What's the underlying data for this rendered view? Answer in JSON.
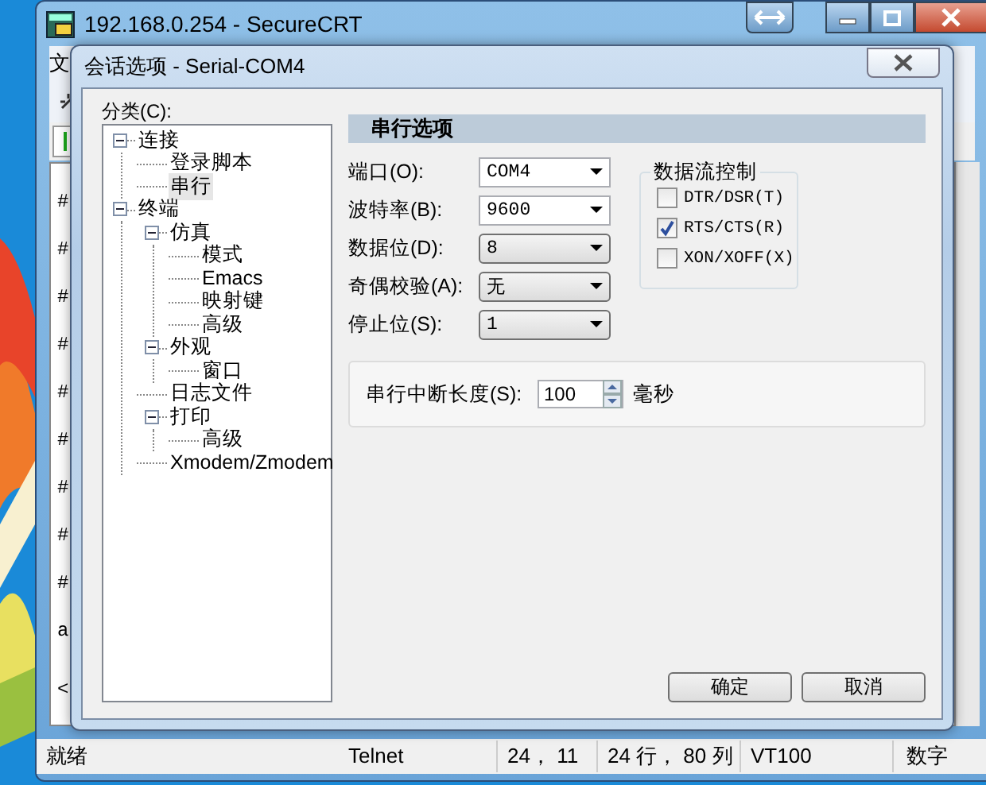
{
  "window": {
    "title": "192.168.0.254 - SecureCRT"
  },
  "menu": [
    "文"
  ],
  "terminal_lines": [
    "#",
    "#",
    "#",
    "#",
    "#",
    "#",
    "#",
    "#",
    "#",
    "a"
  ],
  "terminal_prompt": "<",
  "dialog": {
    "title": "会话选项 - Serial-COM4",
    "category_label": "分类(C):",
    "tree": [
      {
        "label": "连接",
        "expanded": true,
        "selected": false,
        "children": [
          {
            "label": "登录脚本",
            "selected": false
          },
          {
            "label": "串行",
            "selected": true
          }
        ]
      },
      {
        "label": "终端",
        "expanded": true,
        "selected": false,
        "children": [
          {
            "label": "仿真",
            "expanded": true,
            "selected": false,
            "children": [
              {
                "label": "模式",
                "selected": false
              },
              {
                "label": "Emacs",
                "selected": false
              },
              {
                "label": "映射键",
                "selected": false
              },
              {
                "label": "高级",
                "selected": false
              }
            ]
          },
          {
            "label": "外观",
            "expanded": true,
            "selected": false,
            "children": [
              {
                "label": "窗口",
                "selected": false
              }
            ]
          },
          {
            "label": "日志文件",
            "selected": false
          },
          {
            "label": "打印",
            "expanded": true,
            "selected": false,
            "children": [
              {
                "label": "高级",
                "selected": false
              }
            ]
          },
          {
            "label": "Xmodem/Zmodem",
            "selected": false
          }
        ]
      }
    ],
    "section_title": "串行选项",
    "fields": [
      {
        "label": "端口(O):",
        "value": "COM4",
        "kind": "editable"
      },
      {
        "label": "波特率(B):",
        "value": "9600",
        "kind": "editable"
      },
      {
        "label": "数据位(D):",
        "value": "8",
        "kind": "list"
      },
      {
        "label": "奇偶校验(A):",
        "value": "无",
        "kind": "list"
      },
      {
        "label": "停止位(S):",
        "value": "1",
        "kind": "list"
      }
    ],
    "flow_control": {
      "title": "数据流控制",
      "options": [
        {
          "label": "DTR/DSR(T)",
          "checked": false
        },
        {
          "label": "RTS/CTS(R)",
          "checked": true
        },
        {
          "label": "XON/XOFF(X)",
          "checked": false
        }
      ]
    },
    "break_length": {
      "label": "串行中断长度(S):",
      "value": "100",
      "unit": "毫秒"
    },
    "buttons": [
      "确定",
      "取消"
    ]
  },
  "status_bar": [
    "就绪",
    "Telnet",
    "24， 11",
    "24 行， 80 列",
    "VT100",
    "数字"
  ]
}
